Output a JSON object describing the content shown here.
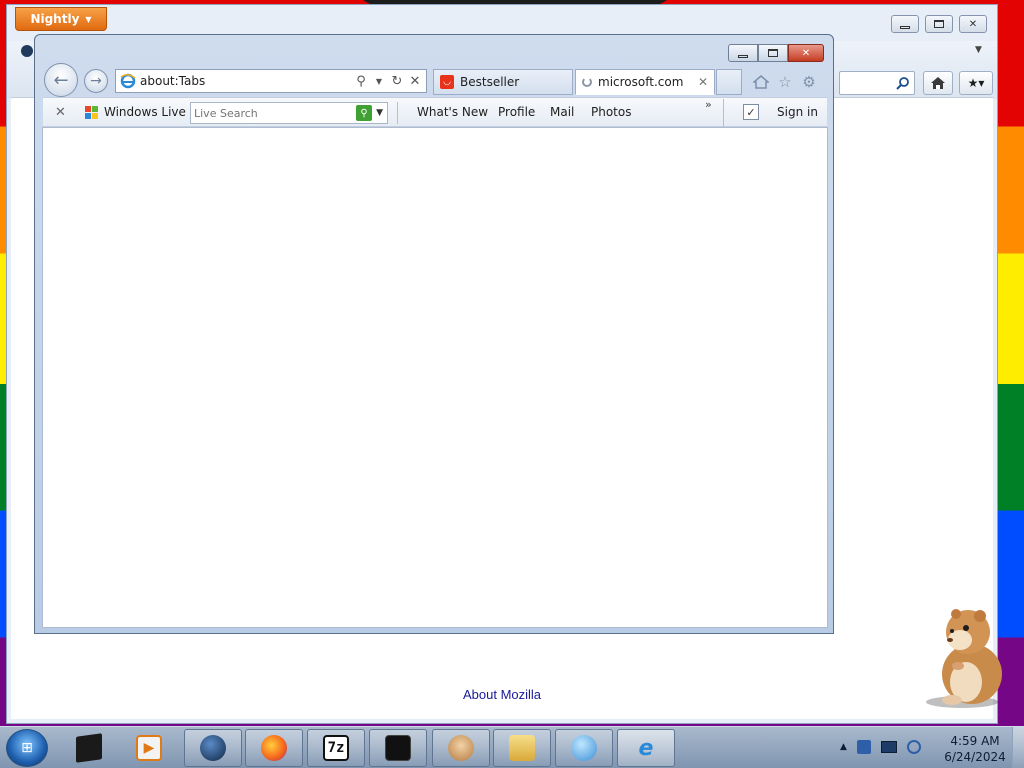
{
  "firefox": {
    "menu_label": "Nightly",
    "about_link": "About Mozilla",
    "caption": {
      "min": "▭",
      "max": "▢",
      "close": "✕"
    }
  },
  "ie": {
    "address": "about:Tabs",
    "tabs": [
      {
        "label": "Bestseller",
        "icon": "bestseller-favicon"
      },
      {
        "label": "microsoft.com",
        "icon": "loading-spinner-icon"
      }
    ],
    "caption": {
      "min": "▭",
      "max": "▢",
      "close": "✕"
    },
    "toolbar_icons": [
      "home-icon",
      "favorites-star-icon",
      "tools-gear-icon"
    ]
  },
  "windows_live": {
    "label": "Windows Live",
    "search_placeholder": "Live Search",
    "links": [
      "What's New",
      "Profile",
      "Mail",
      "Photos"
    ],
    "more": "»",
    "sign_in": "Sign in"
  },
  "taskbar": {
    "apps": [
      "black-box-app-icon",
      "media-player-icon",
      "globe-app-icon",
      "firefox-icon",
      "7zip-icon",
      "terminal-icon",
      "hamster-icon",
      "file-explorer-icon",
      "shell-app-icon",
      "internet-explorer-icon"
    ],
    "app_labels": {
      "sevenzip": "7z"
    },
    "clock_time": "4:59 AM",
    "clock_date": "6/24/2024"
  }
}
